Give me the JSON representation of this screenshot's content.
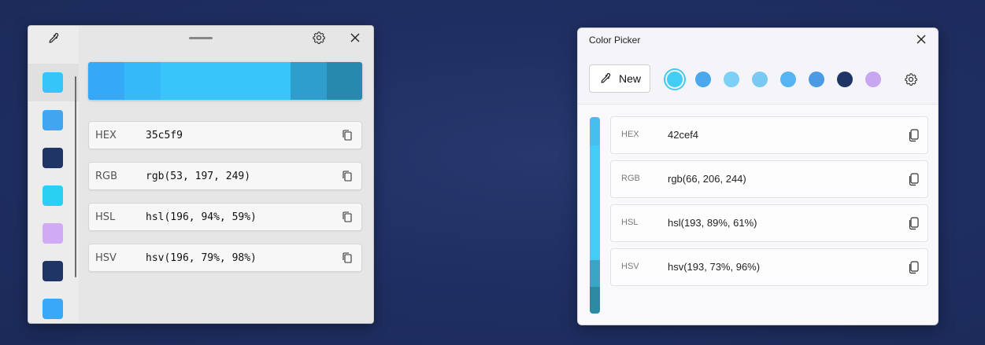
{
  "left_window": {
    "history": [
      {
        "color": "#35c5f9"
      },
      {
        "color": "#42a5f0"
      },
      {
        "color": "#1f3566"
      },
      {
        "color": "#2ad0f2"
      },
      {
        "color": "#d0aaf5"
      },
      {
        "color": "#1f3566"
      },
      {
        "color": "#3aa8f8"
      }
    ],
    "shades": [
      "#35a8f8",
      "#35b9f8",
      "#38c5f9",
      "#2e9fcc",
      "#268aae"
    ],
    "rows": [
      {
        "label": "HEX",
        "value": "35c5f9"
      },
      {
        "label": "RGB",
        "value": "rgb(53, 197, 249)"
      },
      {
        "label": "HSL",
        "value": "hsl(196, 94%, 59%)"
      },
      {
        "label": "HSV",
        "value": "hsv(196, 79%, 98%)"
      }
    ]
  },
  "right_window": {
    "title": "Color Picker",
    "new_button_label": "New",
    "recent_colors": [
      "#42cef4",
      "#4aa8ee",
      "#7ccff5",
      "#79c9f2",
      "#55b5f2",
      "#4a9ae6",
      "#1f3566",
      "#c8a6f0"
    ],
    "shades": [
      "#45c0ee",
      "#42cef4",
      "#3aa6c4",
      "#2c8aa3"
    ],
    "rows": [
      {
        "label": "HEX",
        "value": "42cef4"
      },
      {
        "label": "RGB",
        "value": "rgb(66, 206, 244)"
      },
      {
        "label": "HSL",
        "value": "hsl(193, 89%, 61%)"
      },
      {
        "label": "HSV",
        "value": "hsv(193, 73%, 96%)"
      }
    ]
  },
  "icons": {
    "eyedropper": "eyedropper-icon",
    "settings": "gear-icon",
    "close": "close-icon",
    "copy": "copy-icon",
    "drag": "drag-handle"
  }
}
